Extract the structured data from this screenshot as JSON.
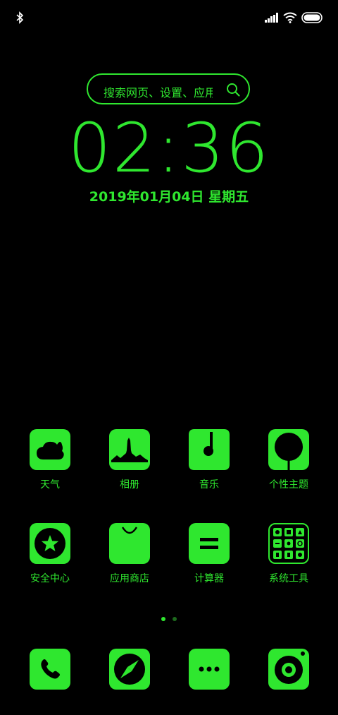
{
  "status_bar": {
    "icons": [
      "bluetooth-icon",
      "signal-icon",
      "wifi-icon",
      "battery-icon"
    ]
  },
  "search": {
    "placeholder": "搜索网页、设置、应用"
  },
  "clock": {
    "time": "02:36",
    "date": "2019年01月04日 星期五"
  },
  "apps_row1": [
    {
      "label": "天气",
      "icon": "weather-icon"
    },
    {
      "label": "相册",
      "icon": "gallery-icon"
    },
    {
      "label": "音乐",
      "icon": "music-icon"
    },
    {
      "label": "个性主题",
      "icon": "themes-icon"
    }
  ],
  "apps_row2": [
    {
      "label": "安全中心",
      "icon": "security-icon"
    },
    {
      "label": "应用商店",
      "icon": "app-store-icon"
    },
    {
      "label": "计算器",
      "icon": "calculator-icon"
    },
    {
      "label": "系统工具",
      "icon": "system-tools-icon"
    }
  ],
  "page_indicator": {
    "pages": 2,
    "current": 1
  },
  "dock": [
    {
      "icon": "phone-icon"
    },
    {
      "icon": "browser-icon"
    },
    {
      "icon": "messages-icon"
    },
    {
      "icon": "camera-icon"
    }
  ],
  "colors": {
    "accent": "#2fe72f",
    "background": "#000000"
  }
}
